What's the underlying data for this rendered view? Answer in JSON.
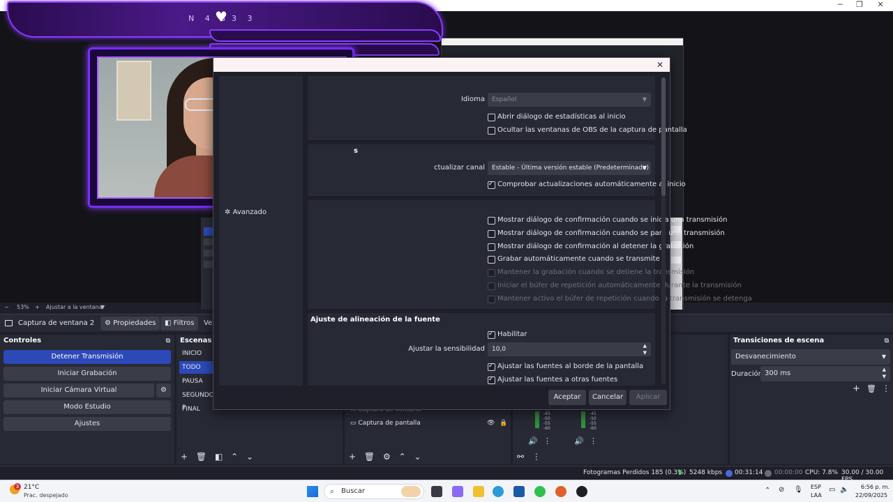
{
  "preview": {
    "zoom_minus": "−",
    "zoom_level": "53%",
    "zoom_plus": "+",
    "fit_label": "Ajustar a la ventana",
    "banner_code_left": "N 4 3",
    "banner_code_right": "3 3"
  },
  "source_toolbar": {
    "source_name": "Captura de ventana 2",
    "properties_label": "Propiedades",
    "filters_label": "Filtros",
    "window_label": "Ven"
  },
  "controls": {
    "title": "Controles",
    "stop_stream": "Detener Transmisión",
    "start_recording": "Iniciar Grabación",
    "start_virtual_cam": "Iniciar Cámara Virtual",
    "studio_mode": "Modo Estudio",
    "settings": "Ajustes"
  },
  "scenes": {
    "title": "Escenas",
    "items": [
      "INICIO",
      "TODO",
      "PAUSA",
      "SEGUNDO P",
      "FINAL"
    ],
    "selected": "TODO"
  },
  "sources": {
    "items": [
      {
        "name": "Captura de ventana"
      },
      {
        "name": "Captura de pantalla"
      }
    ]
  },
  "mixer": {
    "ticks": [
      "-45",
      "-50",
      "-55",
      "-60"
    ]
  },
  "transitions": {
    "title": "Transiciones de escena",
    "type": "Desvanecimiento",
    "duration_label": "Duración",
    "duration_value": "300 ms"
  },
  "status": {
    "dropped_frames": "Fotogramas Perdidos 185 (0.3%)",
    "bitrate": "5248 kbps",
    "stream_time": "00:31:14",
    "rec_time": "00:00:00",
    "cpu": "CPU: 7.8%",
    "fps": "30.00 / 30.00 FPS"
  },
  "dialog": {
    "sidebar_advanced": "Avanzado",
    "general": {
      "language_label": "Idioma",
      "language_value": "Español",
      "stats_on_start": "Abrir diálogo de estadísticas al inicio",
      "hide_obs_windows": "Ocultar las ventanas de OBS de la captura de pantalla"
    },
    "updates": {
      "section_fragment": "s",
      "channel_label": "ctualizar canal",
      "channel_value": "Estable - Última versión estable (Predeterminado)",
      "auto_check": "Comprobar actualizaciones automáticamente al inicio"
    },
    "output": {
      "confirm_start": "Mostrar diálogo de confirmación cuando se inicia una transmisión",
      "confirm_stop": "Mostrar diálogo de confirmación cuando se para una transmisión",
      "confirm_stop_rec": "Mostrar diálogo de confirmación al detener la grabación",
      "auto_record": "Grabar automáticamente cuando se transmite",
      "keep_recording": "Mantener la grabación cuando se detiene la transmisión",
      "replay_auto": "Iniciar el búfer de repetición automáticamente durante la transmisión",
      "replay_keep": "Mantener activo el búfer de repetición cuando la transmisión se detenga"
    },
    "snapping": {
      "title": "Ajuste de alineación de la fuente",
      "enable": "Habilitar",
      "sensitivity_label": "Ajustar la sensibilidad",
      "sensitivity_value": "10,0",
      "snap_edges": "Ajustar las fuentes al borde de la pantalla",
      "snap_other": "Ajustar las fuentes a otras fuentes"
    },
    "buttons": {
      "ok": "Aceptar",
      "cancel": "Cancelar",
      "apply": "Aplicar"
    }
  },
  "taskbar": {
    "weather_temp": "21°C",
    "weather_desc": "Prac. despejado",
    "weather_badge": "3",
    "search_placeholder": "Buscar",
    "lang_top": "ESP",
    "lang_bottom": "LAA",
    "time": "6:56 p. m.",
    "date": "22/09/2025"
  },
  "colors": {
    "accent_blue": "#2c49b8",
    "neon_purple": "#8a3cff",
    "panel_bg": "#272934",
    "app_bg": "#1e1f29"
  }
}
